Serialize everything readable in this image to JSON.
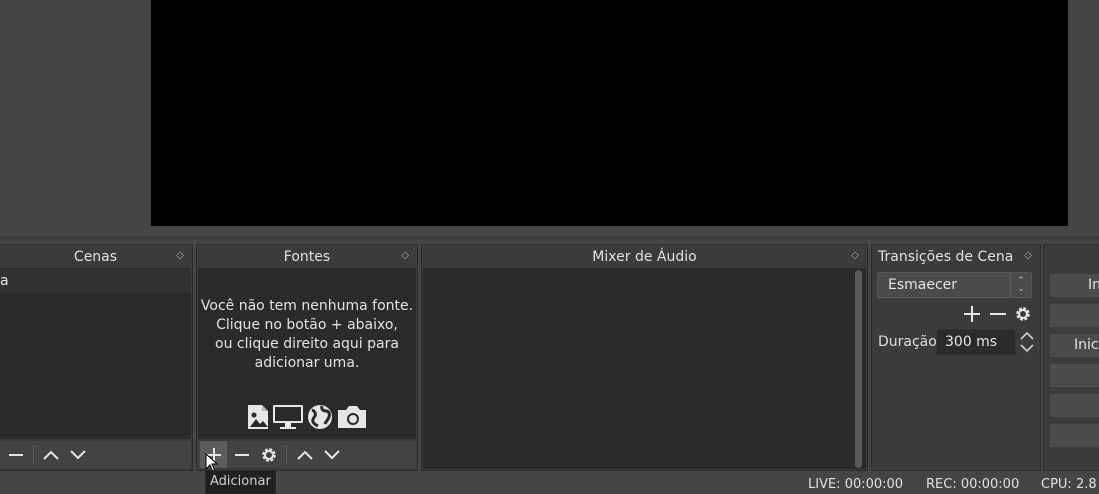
{
  "scenes": {
    "title": "Cenas",
    "items": [
      "a"
    ]
  },
  "sources": {
    "title": "Fontes",
    "empty_lines": [
      "Você não tem nenhuma fonte.",
      "Clique no botão + abaixo,",
      "ou clique direito aqui para",
      "adicionar uma."
    ],
    "source_icons": [
      "image-icon",
      "monitor-icon",
      "globe-icon",
      "camera-icon"
    ]
  },
  "mixer": {
    "title": "Mixer de Áudio"
  },
  "transitions": {
    "title": "Transições de Cena",
    "selected": "Esmaecer",
    "duration_label": "Duração",
    "duration_value": "300 ms"
  },
  "controls": {
    "buttons": [
      "Inic",
      "I",
      "Inicia",
      "",
      "",
      ""
    ]
  },
  "status": {
    "live": "LIVE: 00:00:00",
    "rec": "REC: 00:00:00",
    "cpu": "CPU: 2.8"
  },
  "tooltip": "Adicionar",
  "colors": {
    "background": "#454545",
    "dock": "#3b3b3b",
    "panel": "#2a2a2a",
    "preview": "#000000"
  }
}
